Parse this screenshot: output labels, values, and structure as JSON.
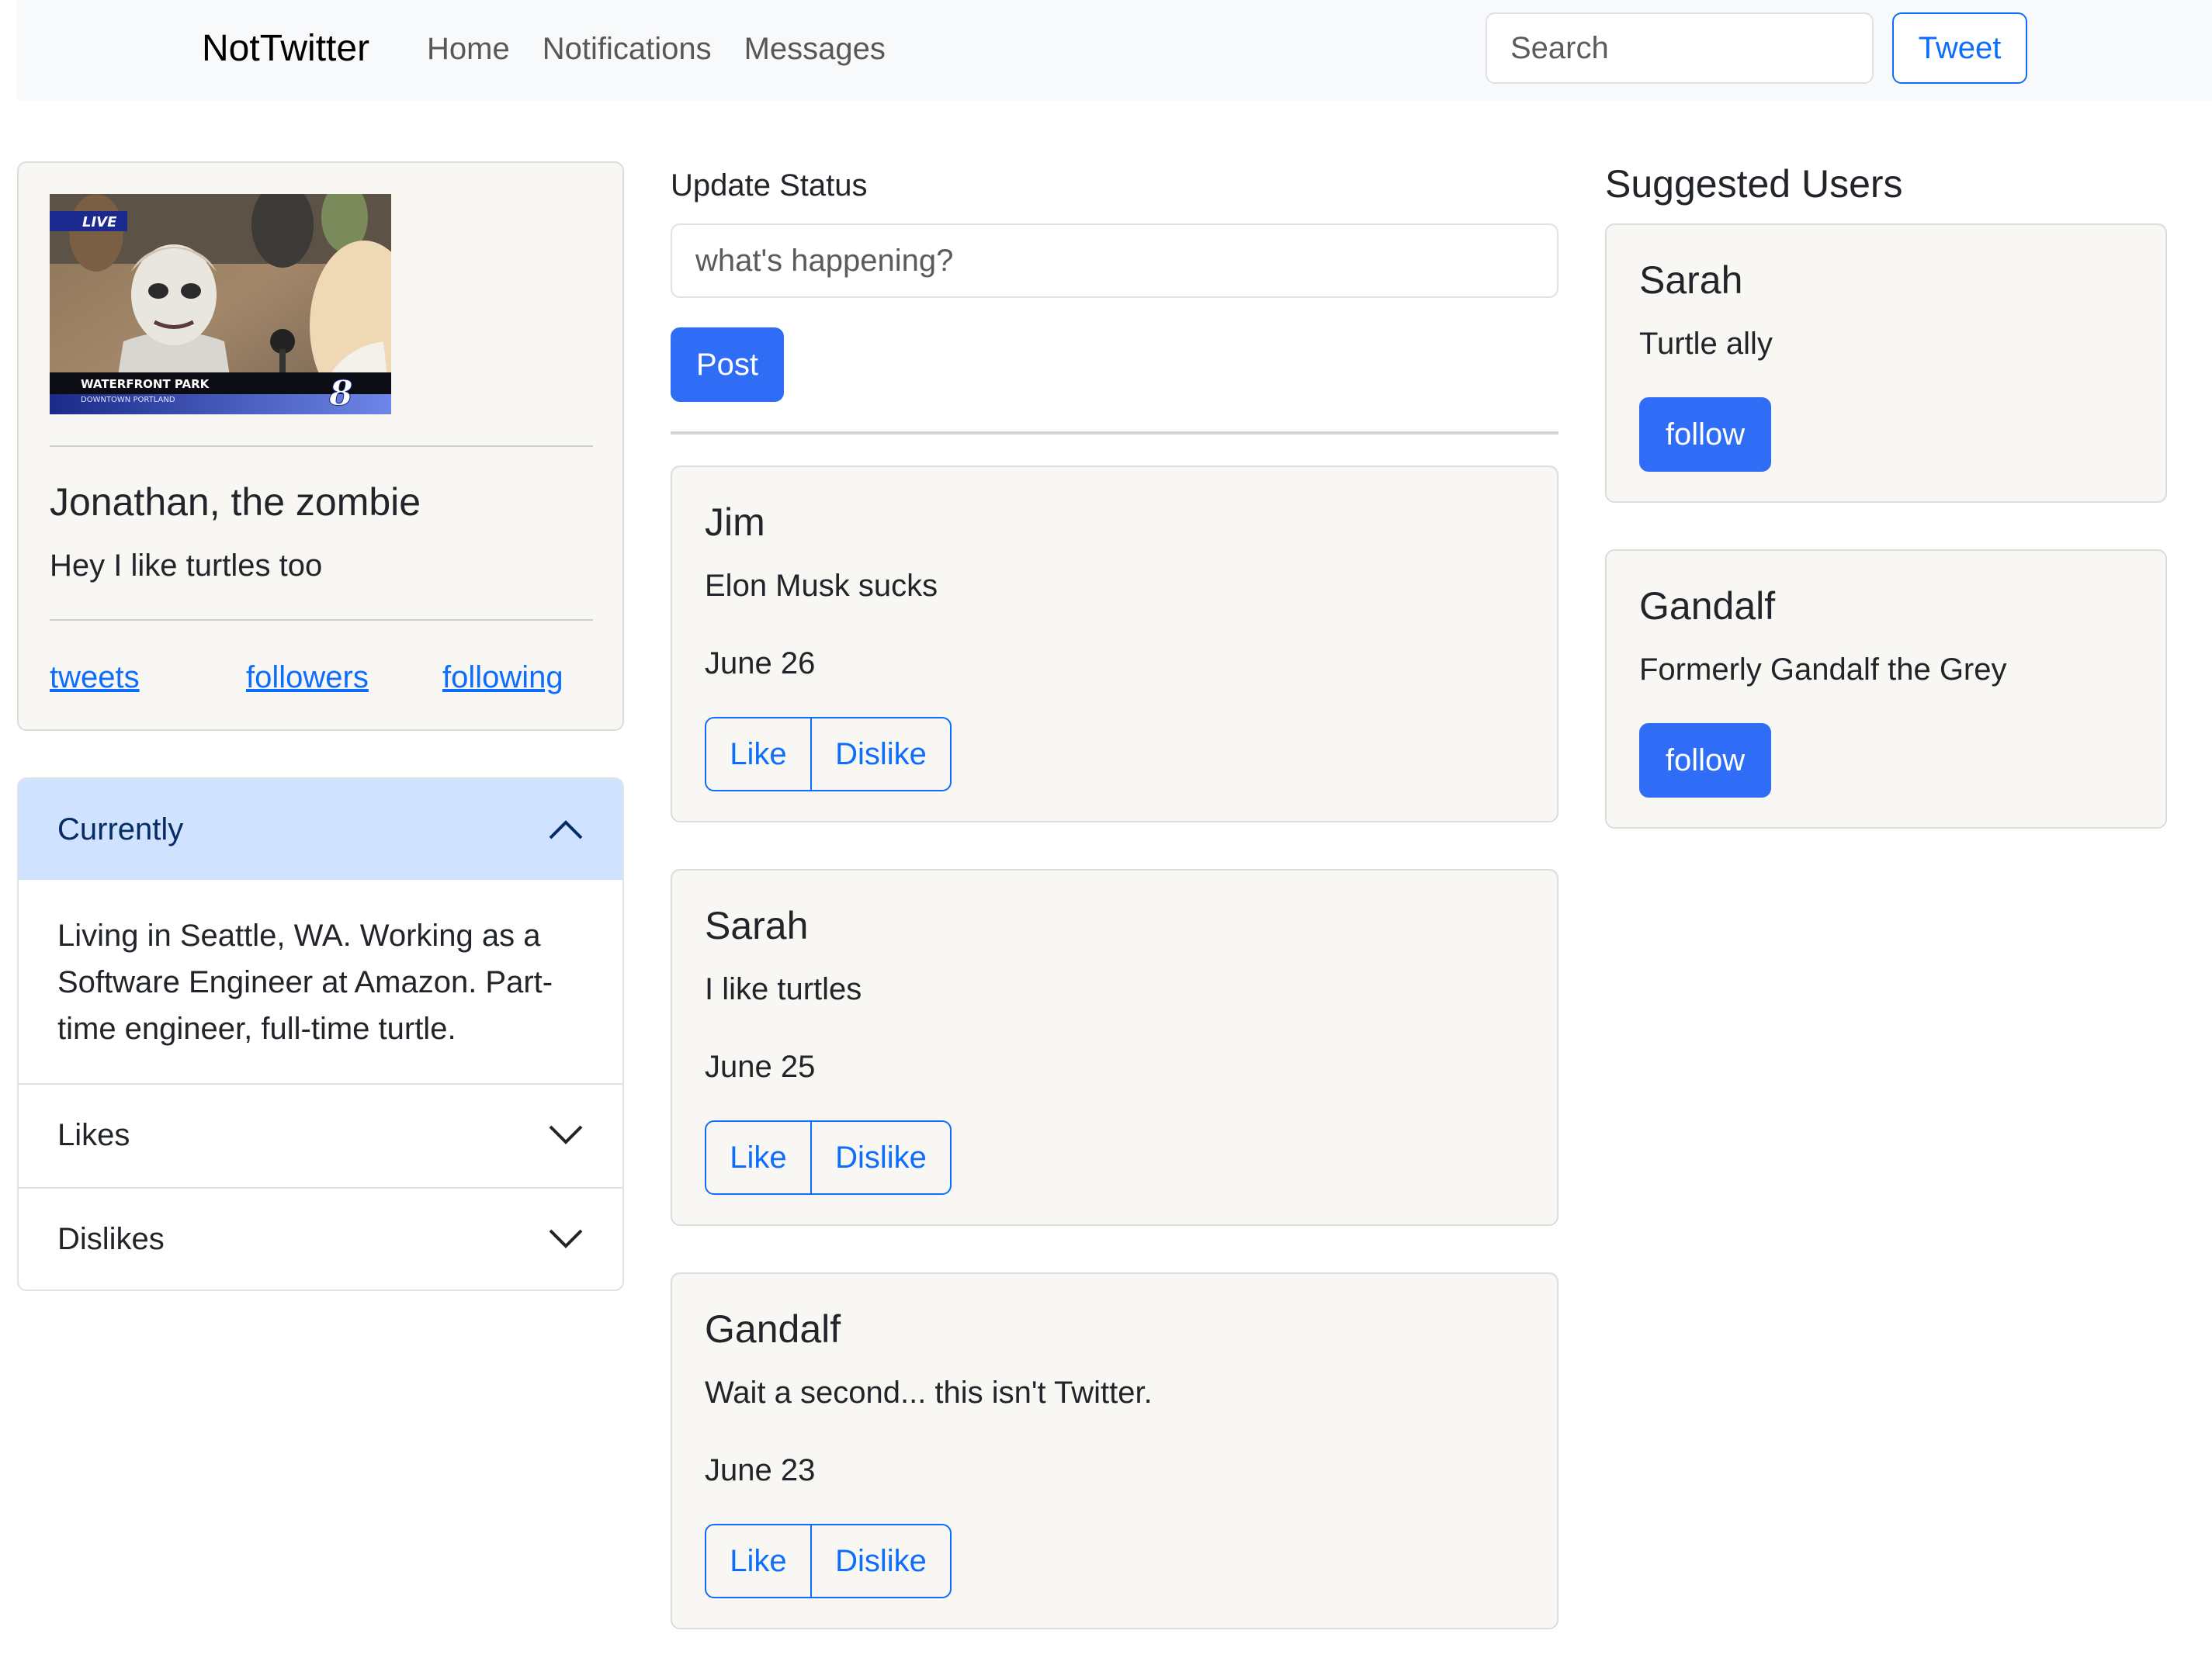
{
  "navbar": {
    "brand": "NotTwitter",
    "links": [
      "Home",
      "Notifications",
      "Messages"
    ],
    "search_placeholder": "Search",
    "tweet_button": "Tweet"
  },
  "profile": {
    "image_caption_top": "LIVE",
    "image_caption_bottom": "WATERFRONT PARK",
    "image_caption_sub": "DOWNTOWN PORTLAND",
    "image_channel": "8",
    "name": "Jonathan, the zombie",
    "bio": "Hey I like turtles too",
    "links": [
      "tweets",
      "followers",
      "following"
    ]
  },
  "accordion": {
    "sections": [
      {
        "title": "Currently",
        "open": true,
        "body": "Living in Seattle, WA. Working as a Software Engineer at Amazon. Part-time engineer, full-time turtle."
      },
      {
        "title": "Likes",
        "open": false
      },
      {
        "title": "Dislikes",
        "open": false
      }
    ]
  },
  "status": {
    "label": "Update Status",
    "placeholder": "what's happening?",
    "post_button": "Post"
  },
  "feed": {
    "like_label": "Like",
    "dislike_label": "Dislike",
    "tweets": [
      {
        "author": "Jim",
        "text": "Elon Musk sucks",
        "date": "June 26"
      },
      {
        "author": "Sarah",
        "text": "I like turtles",
        "date": "June 25"
      },
      {
        "author": "Gandalf",
        "text": "Wait a second... this isn't Twitter.",
        "date": "June 23"
      }
    ]
  },
  "suggested": {
    "title": "Suggested Users",
    "follow_label": "follow",
    "users": [
      {
        "name": "Sarah",
        "bio": "Turtle ally"
      },
      {
        "name": "Gandalf",
        "bio": "Formerly Gandalf the Grey"
      }
    ]
  },
  "colors": {
    "primary": "#0d6efd",
    "button_fill": "#2f6df6",
    "navbar_bg": "#f8f9fa",
    "card_bg": "#f8f7f4",
    "accordion_active_bg": "#cfe2ff"
  }
}
